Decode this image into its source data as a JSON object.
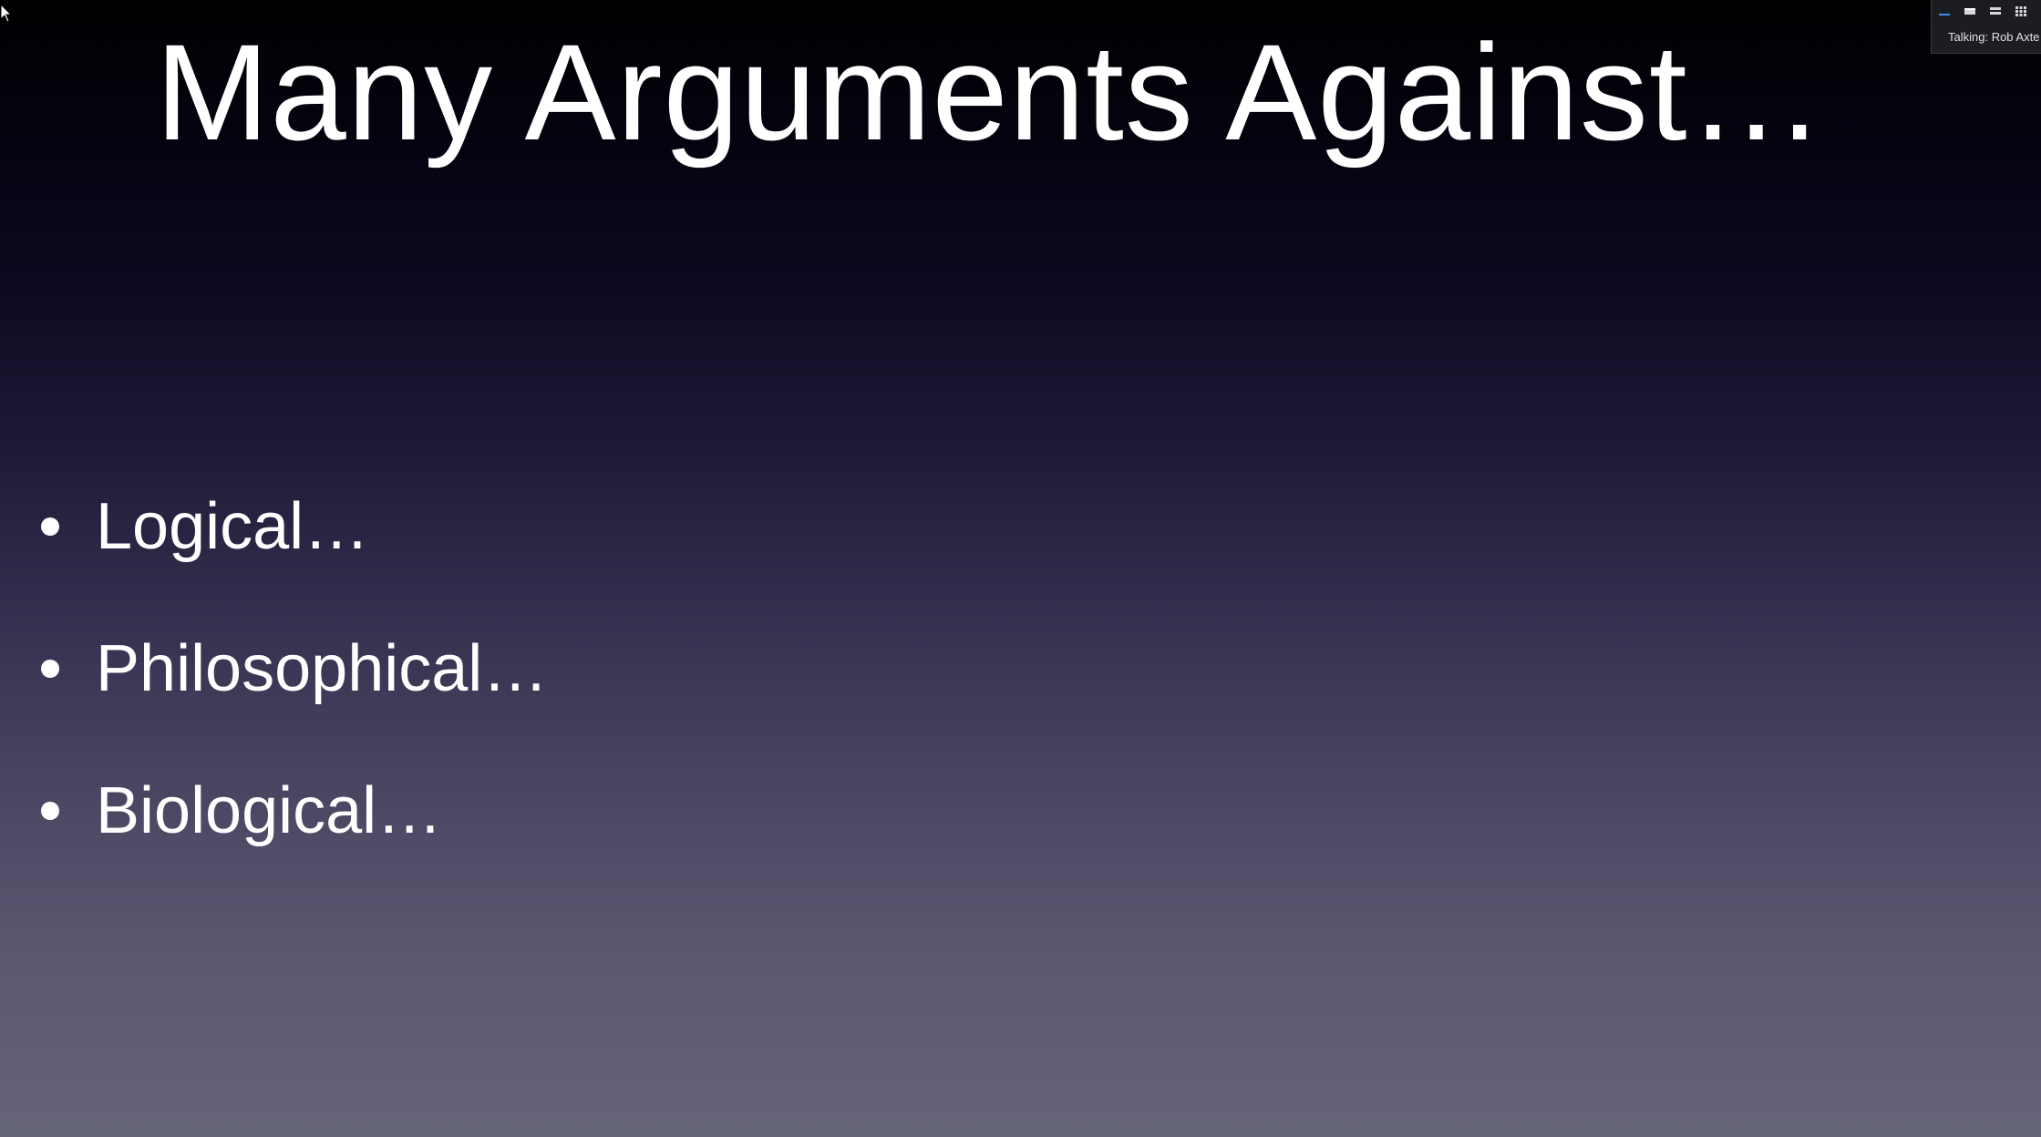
{
  "slide": {
    "title": "Many Arguments Against…",
    "bullets": [
      {
        "text": "Logical…"
      },
      {
        "text": "Philosophical…"
      },
      {
        "text": "Biological…"
      }
    ]
  },
  "meeting_overlay": {
    "view_buttons": [
      {
        "icon": "speaker-view-icon",
        "active": true
      },
      {
        "icon": "single-window-icon",
        "active": false
      },
      {
        "icon": "stacked-view-icon",
        "active": false
      },
      {
        "icon": "gallery-grid-icon",
        "active": false
      }
    ],
    "talking_label": "Talking: Rob Axte"
  },
  "colors": {
    "background_top": "#000000",
    "background_bottom": "#656479",
    "text": "#ffffff",
    "active_view": "#3a8df0"
  }
}
